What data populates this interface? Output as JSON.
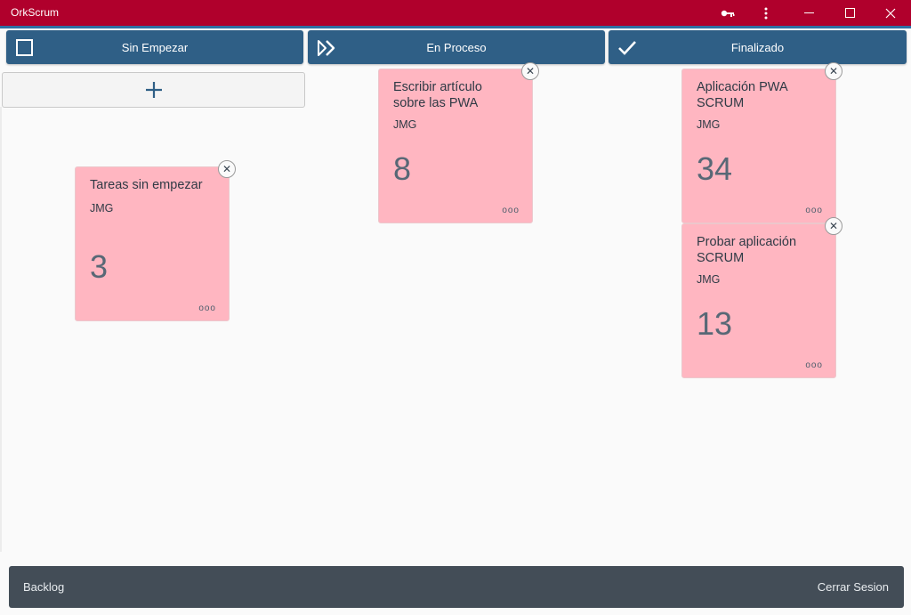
{
  "window": {
    "title": "OrkScrum",
    "controls": [
      "key-icon",
      "more-vertical-icon",
      "minimize-icon",
      "maximize-icon",
      "close-icon"
    ]
  },
  "columns": [
    {
      "label": "Sin Empezar",
      "icon": "checkbox-empty-icon"
    },
    {
      "label": "En Proceso",
      "icon": "double-chevron-right-icon"
    },
    {
      "label": "Finalizado",
      "icon": "checkmark-icon"
    }
  ],
  "add_button": {
    "icon": "plus-icon"
  },
  "cards": [
    {
      "title": "Tareas sin empezar",
      "owner": "JMG",
      "points": "3",
      "column": "Sin Empezar"
    },
    {
      "title": "Escribir artículo sobre las PWA",
      "owner": "JMG",
      "points": "8",
      "column": "En Proceso"
    },
    {
      "title": "Aplicación PWA SCRUM",
      "owner": "JMG",
      "points": "34",
      "column": "Finalizado"
    },
    {
      "title": "Probar aplicación SCRUM",
      "owner": "JMG",
      "points": "13",
      "column": "Finalizado"
    }
  ],
  "card_actions": {
    "close": "✕",
    "more": "ooo"
  },
  "bottom": {
    "left": "Backlog",
    "right": "Cerrar Sesion"
  },
  "colors": {
    "titlebar": "#b0002c",
    "column_header": "#2f5f86",
    "card": "#ffb6c1",
    "bottombar": "#434d57"
  }
}
